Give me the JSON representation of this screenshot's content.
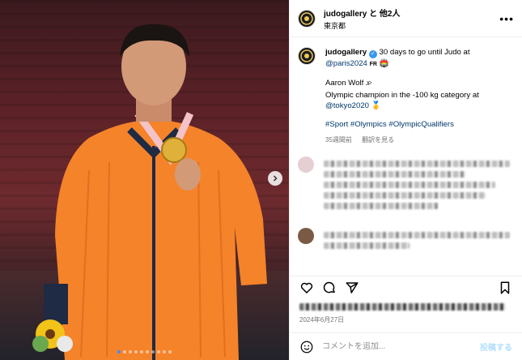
{
  "header": {
    "username": "judogallery",
    "connector": "と",
    "others": "他2人",
    "location": "東京都",
    "more_icon": "more-horizontal-icon"
  },
  "caption": {
    "username": "judogallery",
    "line1": "30 days to go until Judo at",
    "mention_paris": "@paris2024",
    "flag_fr": "FR",
    "paris_emoji": "🏟️",
    "name": "Aaron Wolf",
    "flag_jp": "JP",
    "line3": "Olympic champion in the -100 kg category at",
    "mention_tokyo": "@tokyo2020",
    "medal_emoji": "🥇",
    "hashtags": "#Sport #Olympics #OlympicQualifiers",
    "age": "35週間前",
    "translate": "翻訳を見る"
  },
  "comments": [
    {
      "avatar_color": "#e5cfd3"
    },
    {
      "avatar_color": "#7a5a45"
    }
  ],
  "actions": {
    "like_icon": "heart-icon",
    "comment_icon": "comment-icon",
    "share_icon": "send-icon",
    "save_icon": "bookmark-icon"
  },
  "post_date": "2024年6月27日",
  "comment_box": {
    "placeholder": "コメントを追加...",
    "post_label": "投稿する"
  },
  "carousel": {
    "slide_count": 10,
    "active_index": 0
  },
  "colors": {
    "link": "#00376b",
    "verified": "#3897f0",
    "jacket": "#f5832a",
    "post_button": "#b2dffc"
  }
}
